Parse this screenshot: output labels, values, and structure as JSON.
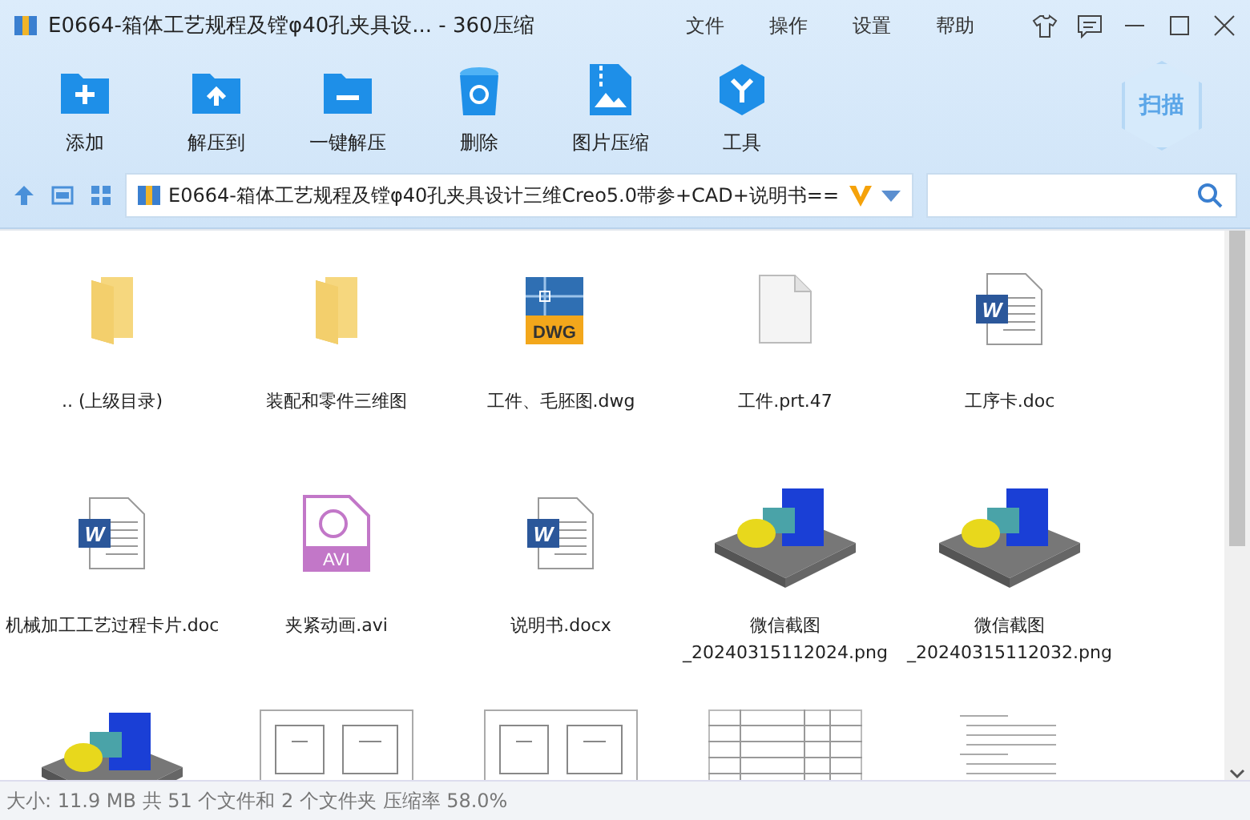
{
  "window": {
    "title": "E0664-箱体工艺规程及镗φ40孔夹具设... - 360压缩"
  },
  "menu": [
    "文件",
    "操作",
    "设置",
    "帮助"
  ],
  "toolbar": [
    {
      "kind": "add",
      "label": "添加"
    },
    {
      "kind": "extract",
      "label": "解压到"
    },
    {
      "kind": "oneclick",
      "label": "一键解压"
    },
    {
      "kind": "delete",
      "label": "删除"
    },
    {
      "kind": "image",
      "label": "图片压缩"
    },
    {
      "kind": "tools",
      "label": "工具"
    }
  ],
  "scan_button": "扫描",
  "address": {
    "path": "E0664-箱体工艺规程及镗φ40孔夹具设计三维Creo5.0带参+CAD+说明书=="
  },
  "files": [
    {
      "kind": "folder",
      "name": ".. (上级目录)"
    },
    {
      "kind": "folder",
      "name": "装配和零件三维图"
    },
    {
      "kind": "dwg",
      "badge": "DWG",
      "name": "工件、毛胚图.dwg"
    },
    {
      "kind": "blank",
      "name": "工件.prt.47"
    },
    {
      "kind": "word",
      "badge": "W",
      "name": "工序卡.doc"
    },
    {
      "kind": "word",
      "badge": "W",
      "name": "机械加工工艺过程卡片.doc"
    },
    {
      "kind": "avi",
      "badge": "AVI",
      "name": "夹紧动画.avi"
    },
    {
      "kind": "word",
      "badge": "W",
      "name": "说明书.docx"
    },
    {
      "kind": "model",
      "name": "微信截图_20240315112024.png"
    },
    {
      "kind": "model2",
      "name": "微信截图_20240315112032.png"
    },
    {
      "kind": "model3"
    },
    {
      "kind": "sheet"
    },
    {
      "kind": "sheet"
    },
    {
      "kind": "table"
    },
    {
      "kind": "text"
    }
  ],
  "status_bar": "大小: 11.9 MB 共 51 个文件和 2 个文件夹 压缩率 58.0%"
}
